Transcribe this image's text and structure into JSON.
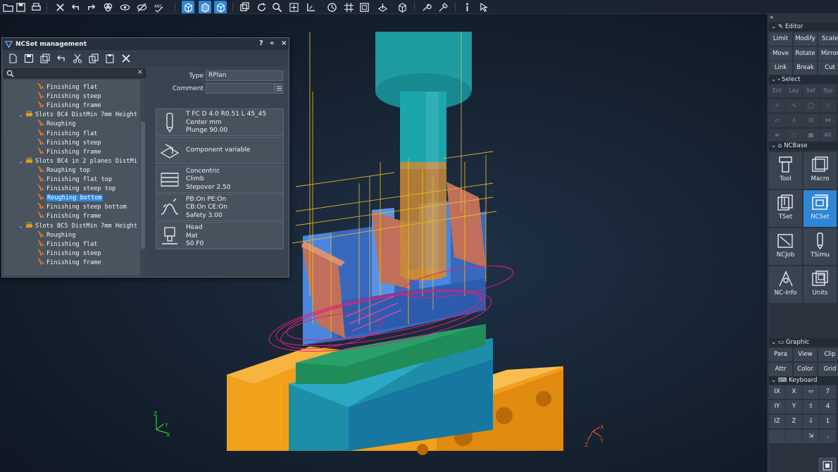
{
  "ncset_panel": {
    "title": "NCSet management",
    "controls": {
      "help": "?",
      "collapse": "«",
      "close": "×"
    },
    "tree": {
      "nodes": [
        {
          "label": "Finishing flat",
          "kind": "op",
          "indent": 2
        },
        {
          "label": "Finishing steep",
          "kind": "op",
          "indent": 2
        },
        {
          "label": "Finishing frame",
          "kind": "op",
          "indent": 2
        },
        {
          "label": "Slots BC4 DistMin 7mm Height",
          "kind": "group",
          "indent": 1
        },
        {
          "label": "Roughing",
          "kind": "op",
          "indent": 2
        },
        {
          "label": "Finishing flat",
          "kind": "op",
          "indent": 2
        },
        {
          "label": "Finishing steep",
          "kind": "op",
          "indent": 2
        },
        {
          "label": "Finishing frame",
          "kind": "op",
          "indent": 2
        },
        {
          "label": "Slots BC4 in 2 planes DistMi",
          "kind": "group",
          "indent": 1
        },
        {
          "label": "Roughing top",
          "kind": "op",
          "indent": 2
        },
        {
          "label": "Finishing flat top",
          "kind": "op",
          "indent": 2
        },
        {
          "label": "Finishing steep top",
          "kind": "op",
          "indent": 2
        },
        {
          "label": "Roughing bottom",
          "kind": "op",
          "indent": 2,
          "selected": true
        },
        {
          "label": "Finishing steep bottom",
          "kind": "op",
          "indent": 2
        },
        {
          "label": "Finishing frame",
          "kind": "op",
          "indent": 2
        },
        {
          "label": "Slots BC5 DistMin 7mm Height",
          "kind": "group",
          "indent": 1
        },
        {
          "label": "Roughing",
          "kind": "op",
          "indent": 2
        },
        {
          "label": "Finishing flat",
          "kind": "op",
          "indent": 2
        },
        {
          "label": "Finishing steep",
          "kind": "op",
          "indent": 2
        },
        {
          "label": "Finishing frame",
          "kind": "op",
          "indent": 2
        }
      ]
    },
    "props": {
      "type_label": "Type",
      "type_value": "RPlan",
      "comment_label": "Comment",
      "comment_value": ""
    },
    "cards": [
      {
        "icon": "tool-icon",
        "lines": [
          "T FC D 4.0 R0.51 L 45_45",
          "Center mm",
          "Plunge 90.00"
        ]
      },
      {
        "icon": "component-icon",
        "lines": [
          "Component variable"
        ]
      },
      {
        "icon": "strategy-icon",
        "lines": [
          "Concentric",
          "Climb",
          "Stepover 2.50"
        ]
      },
      {
        "icon": "link-icon",
        "lines": [
          "PB:On PE:On",
          "CB:On CE:On",
          "Safety 3.00"
        ]
      },
      {
        "icon": "head-icon",
        "lines": [
          "Head",
          "Mat",
          "S0 F0"
        ]
      }
    ]
  },
  "sidebar": {
    "editor": {
      "header": "Editor",
      "buttons": [
        [
          "Limit",
          "Modify",
          "Scale"
        ],
        [
          "Move",
          "Rotate",
          "Mirror"
        ],
        [
          "Link",
          "Break",
          "Cut"
        ]
      ]
    },
    "select": {
      "header": "Select",
      "tabs": [
        "Ent",
        "Lay",
        "Set",
        "Typ"
      ],
      "all_label": "All"
    },
    "ncbase": {
      "header": "NCBase",
      "buttons": [
        "Tool",
        "Macro",
        "TSet",
        "NCSet",
        "NCJob",
        "TSimu",
        "NC-Info",
        "Units"
      ],
      "active": "NCSet"
    },
    "graphic": {
      "header": "Graphic",
      "buttons": [
        [
          "Para",
          "View",
          "Clip"
        ],
        [
          "Attr",
          "Color",
          "Grid"
        ]
      ]
    },
    "keyboard": {
      "header": "Keyboard",
      "rows": [
        [
          "IX",
          "X",
          "⇦",
          "7"
        ],
        [
          "IY",
          "Y",
          "⇧",
          "4"
        ],
        [
          "IZ",
          "Z",
          "⇩",
          "1"
        ],
        [
          "",
          "",
          "⇲",
          "."
        ]
      ]
    }
  },
  "viewport": {
    "axis_left": {
      "z": "Z",
      "y": "Y",
      "x": "X"
    },
    "axis_right": {
      "z": "Z",
      "y": "Y",
      "x": "X"
    },
    "axis_part": "Z"
  },
  "colors": {
    "accent": "#2f86d6",
    "fixture_orange": "#f0a020",
    "spindle_teal": "#1f9aa0",
    "part_blue": "#3a78c8",
    "toolpath_magenta": "#e0207a",
    "wire_yellow": "#f0c020"
  }
}
